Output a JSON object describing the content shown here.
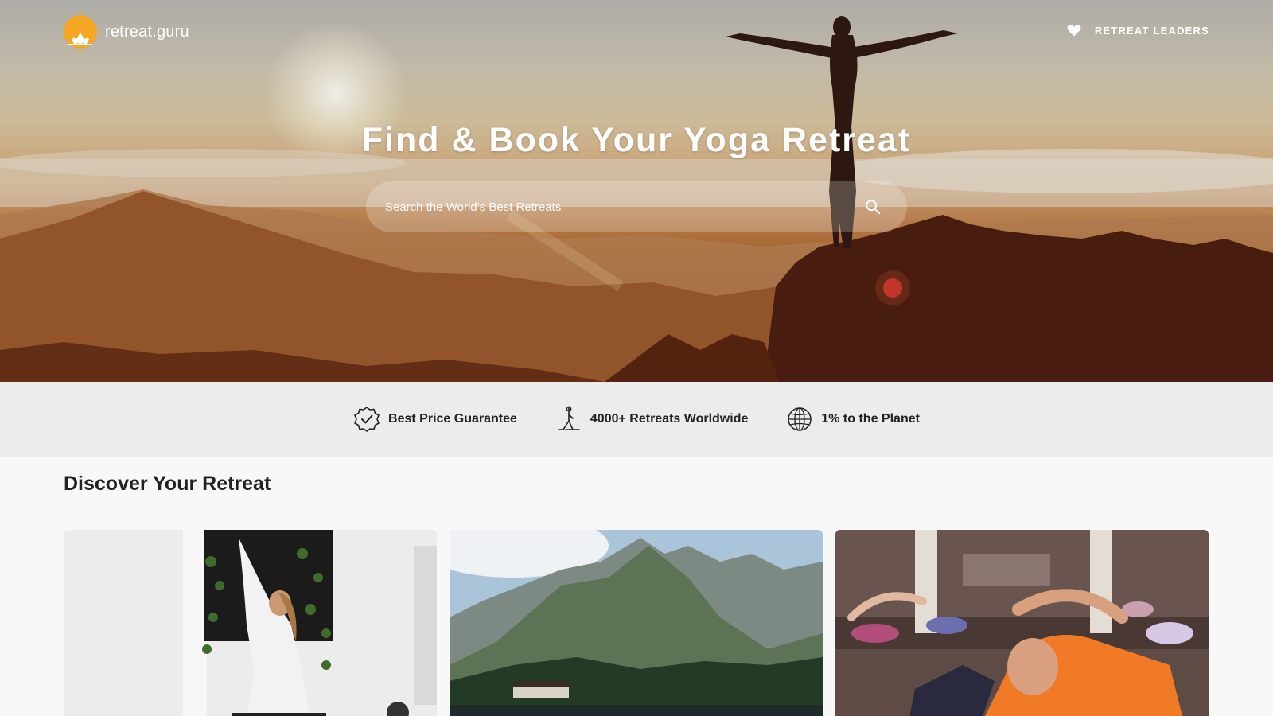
{
  "header": {
    "logo_text": "retreat.guru",
    "nav_link": "RETREAT LEADERS",
    "icons": {
      "logo": "sun-lotus-logo",
      "heart": "heart-icon"
    }
  },
  "hero": {
    "title": "Find & Book Your Yoga Retreat",
    "search": {
      "placeholder": "Search the World’s Best Retreats",
      "value": "",
      "icon": "search-icon"
    }
  },
  "features": [
    {
      "label": "Best Price Guarantee",
      "icon": "check-badge-icon"
    },
    {
      "label": "4000+ Retreats Worldwide",
      "icon": "yoga-pose-icon"
    },
    {
      "label": "1% to the Planet",
      "icon": "globe-icon"
    }
  ],
  "discover": {
    "title": "Discover Your Retreat",
    "cards": [
      {
        "image": "woman-yoga-pose-photo"
      },
      {
        "image": "mountain-lake-photo"
      },
      {
        "image": "group-yoga-class-photo"
      }
    ]
  },
  "colors": {
    "logo_sun": "#f5a623",
    "text_dark": "#222222",
    "features_bg": "#ececec",
    "page_bg": "#f8f8f8"
  }
}
